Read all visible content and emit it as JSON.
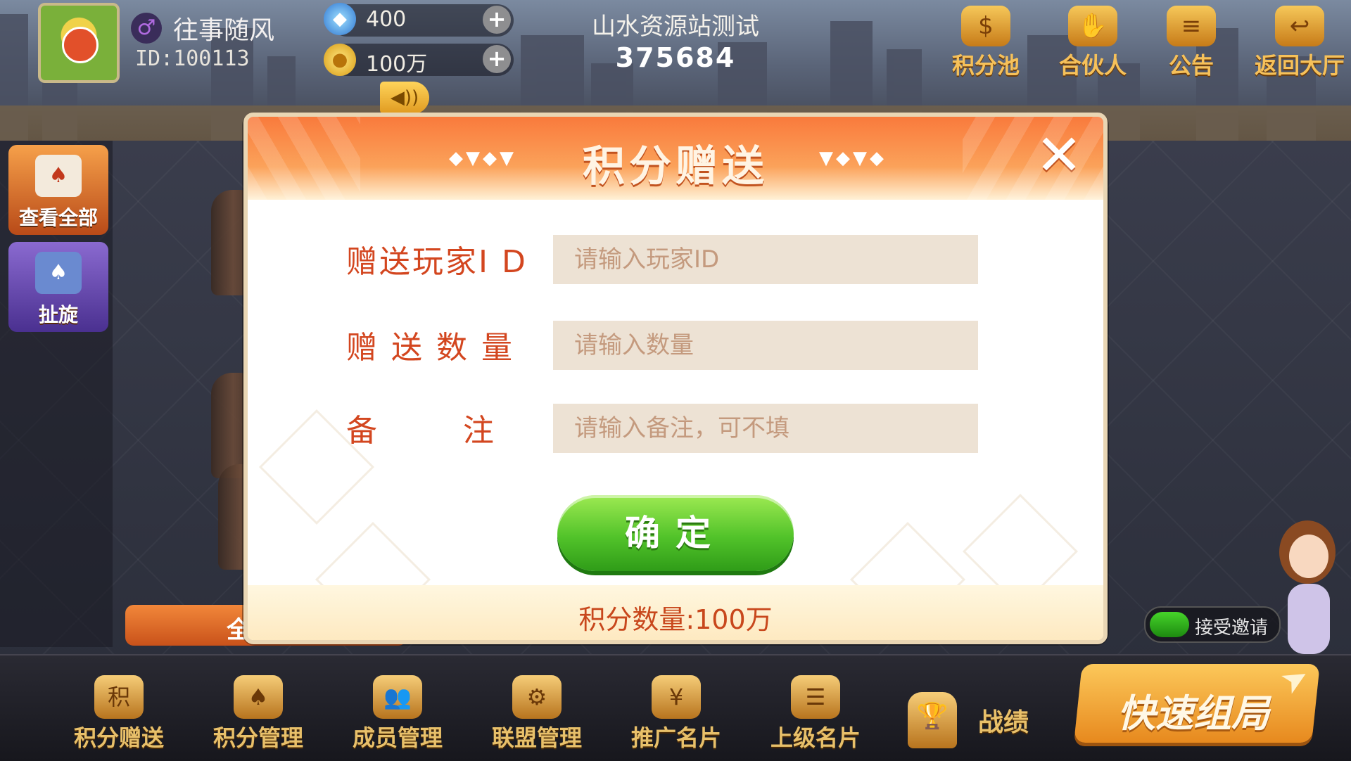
{
  "player": {
    "name": "往事随风",
    "id_text": "ID:100113",
    "gender_icon": "male-symbol"
  },
  "resources": {
    "diamonds": "400",
    "coins": "100万"
  },
  "room": {
    "name": "山水资源站测试",
    "number": "375684"
  },
  "top_actions": [
    {
      "label": "积分池",
      "icon": "coin-pool-icon",
      "glyph": "$"
    },
    {
      "label": "合伙人",
      "icon": "handshake-icon",
      "glyph": "✋"
    },
    {
      "label": "公告",
      "icon": "notice-icon",
      "glyph": "≡"
    },
    {
      "label": "返回大厅",
      "icon": "back-icon",
      "glyph": "↩"
    }
  ],
  "side_buttons": [
    {
      "label": "查看全部",
      "icon": "cards-icon",
      "glyph": "♠"
    },
    {
      "label": "扯旋",
      "icon": "poker-icon",
      "glyph": "♠"
    }
  ],
  "left_strip_label": "全",
  "dialog": {
    "title": "积分赠送",
    "deco_left": "◆▼◆▼",
    "deco_right": "▼◆▼◆",
    "close_glyph": "✕",
    "fields": [
      {
        "label": "赠送玩家I D",
        "placeholder": "请输入玩家ID",
        "value": ""
      },
      {
        "label": "赠 送 数 量",
        "placeholder": "请输入数量",
        "value": ""
      },
      {
        "label": "备       注",
        "placeholder": "请输入备注，可不填",
        "value": ""
      }
    ],
    "confirm_label": "确定",
    "footer_text": "积分数量:100万"
  },
  "invite": {
    "label": "接受邀请",
    "enabled": true
  },
  "bottom_nav": [
    {
      "label": "积分赠送",
      "icon": "points-gift-icon",
      "glyph": "积"
    },
    {
      "label": "积分管理",
      "icon": "points-manage-icon",
      "glyph": "♠"
    },
    {
      "label": "成员管理",
      "icon": "members-icon",
      "glyph": "👥"
    },
    {
      "label": "联盟管理",
      "icon": "alliance-icon",
      "glyph": "⚙"
    },
    {
      "label": "推广名片",
      "icon": "promo-card-icon",
      "glyph": "¥"
    },
    {
      "label": "上级名片",
      "icon": "superior-card-icon",
      "glyph": "☰"
    }
  ],
  "record_label": "战绩",
  "quick_button_label": "快速组局",
  "colors": {
    "dialog_accent": "#d3461f",
    "header_orange": "#f97a3c",
    "confirm_green": "#52c32a",
    "gold_text": "#e8c06a"
  }
}
